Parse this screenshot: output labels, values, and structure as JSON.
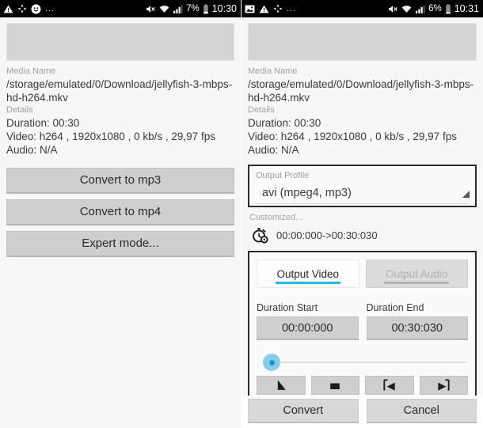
{
  "panels": [
    {
      "statusbar": {
        "icons": [
          "warning-triangle-icon",
          "sync-icon",
          "smiley-face-icon"
        ],
        "overflow": "...",
        "right_icons": [
          "mute-icon",
          "wifi-icon",
          "signal-icon"
        ],
        "battery_percent": "7%",
        "clock": "10:30"
      },
      "media": {
        "name_label": "Media Name",
        "name_value": "/storage/emulated/0/Download/jellyfish-3-mbps-hd-h264.mkv",
        "details_label": "Details",
        "duration": "Duration: 00:30",
        "video": "Video: h264 , 1920x1080 , 0 kb/s , 29,97 fps",
        "audio": "Audio: N/A"
      },
      "buttons": [
        "Convert to mp3",
        "Convert to mp4",
        "Expert mode..."
      ]
    },
    {
      "statusbar": {
        "icons": [
          "image-icon",
          "warning-triangle-icon",
          "sync-icon"
        ],
        "overflow": "...",
        "right_icons": [
          "mute-icon",
          "wifi-icon",
          "signal-icon"
        ],
        "battery_percent": "6%",
        "clock": "10:31"
      },
      "media": {
        "name_label": "Media Name",
        "name_value": "/storage/emulated/0/Download/jellyfish-3-mbps-hd-h264.mkv",
        "details_label": "Details",
        "duration": "Duration: 00:30",
        "video": "Video: h264 , 1920x1080 , 0 kb/s , 29,97 fps",
        "audio": "Audio: N/A"
      },
      "output_profile": {
        "label": "Output Profile",
        "value": "avi (mpeg4, mp3)"
      },
      "customized_label": "Customized...",
      "trim": {
        "icon": "stopwatch-icon",
        "range": "00:00:000->00:30:030"
      },
      "editor": {
        "tabs": [
          {
            "label": "Output Video",
            "active": true
          },
          {
            "label": "Output Audio",
            "active": false
          }
        ],
        "duration_start_label": "Duration Start",
        "duration_start_value": "00:00:000",
        "duration_end_label": "Duration End",
        "duration_end_value": "00:30:030",
        "media_buttons": [
          "play-icon",
          "stop-icon",
          "set-start-marker-icon",
          "set-end-marker-icon"
        ]
      },
      "actions": {
        "convert": "Convert",
        "cancel": "Cancel"
      }
    }
  ],
  "colors": {
    "accent_blue": "#29b6e8",
    "thumb_blue": "#86cdec",
    "thumb_center": "#2196d6",
    "statusbar_bg": "#000000",
    "button_gray": "#cfcfcf"
  }
}
